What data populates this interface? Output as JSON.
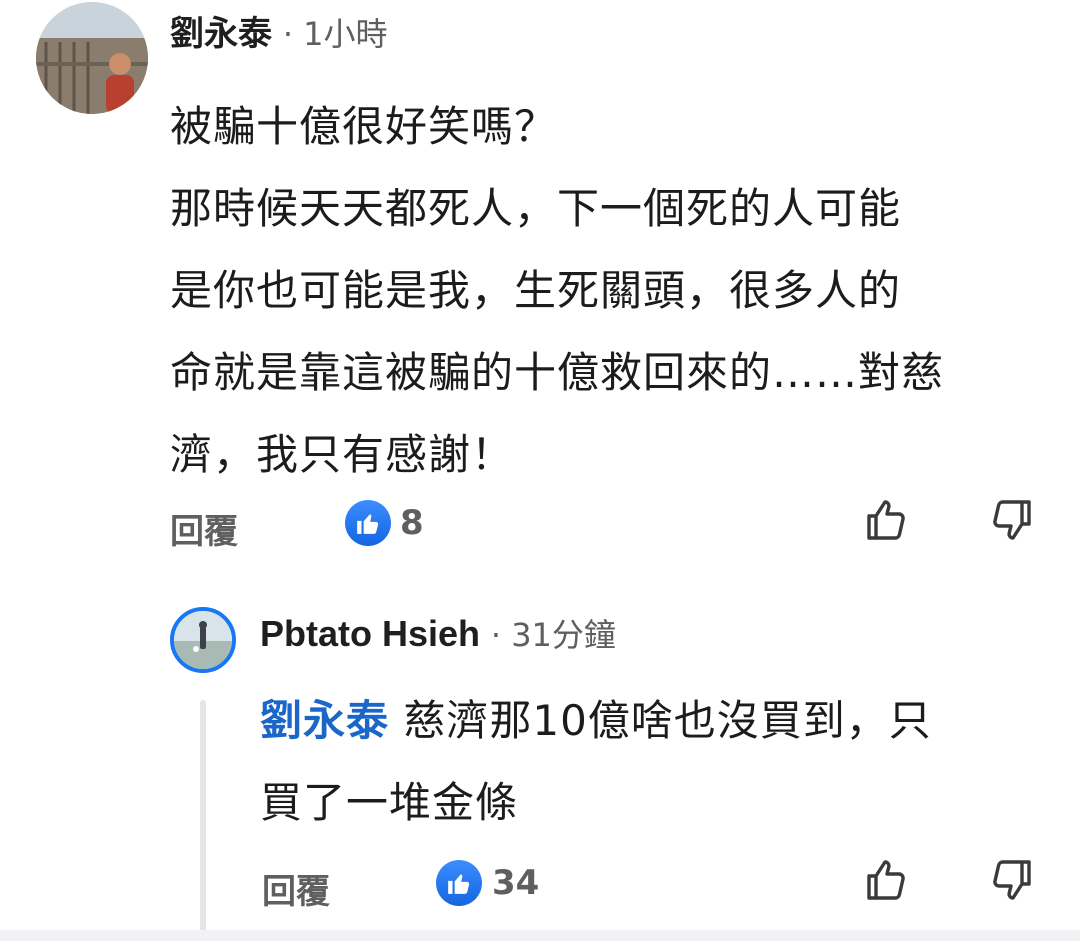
{
  "comment": {
    "author": "劉永泰",
    "meta": "· 1小時",
    "lines": [
      "被騙十億很好笑嗎？",
      "那時候天天都死人，下一個死的人可能",
      "是你也可能是我，生死關頭，很多人的",
      "命就是靠這被騙的十億救回來的……對慈",
      "濟，我只有感謝！"
    ],
    "reply_label": "回覆",
    "like_count": "8"
  },
  "reply": {
    "author": "Pbtato Hsieh",
    "meta": "· 31分鐘",
    "mention": "劉永泰",
    "text_line1": " 慈濟那10億啥也沒買到，只",
    "text_line2": "買了一堆金條",
    "reply_label": "回覆",
    "like_count": "34"
  },
  "colors": {
    "accent": "#1877f2",
    "mention": "#1a66c9",
    "meta": "#5f5f5f"
  },
  "icons": {
    "like_badge": "thumbs-up-icon",
    "like_button": "thumbs-up-outline-icon",
    "dislike_button": "thumbs-down-outline-icon"
  }
}
